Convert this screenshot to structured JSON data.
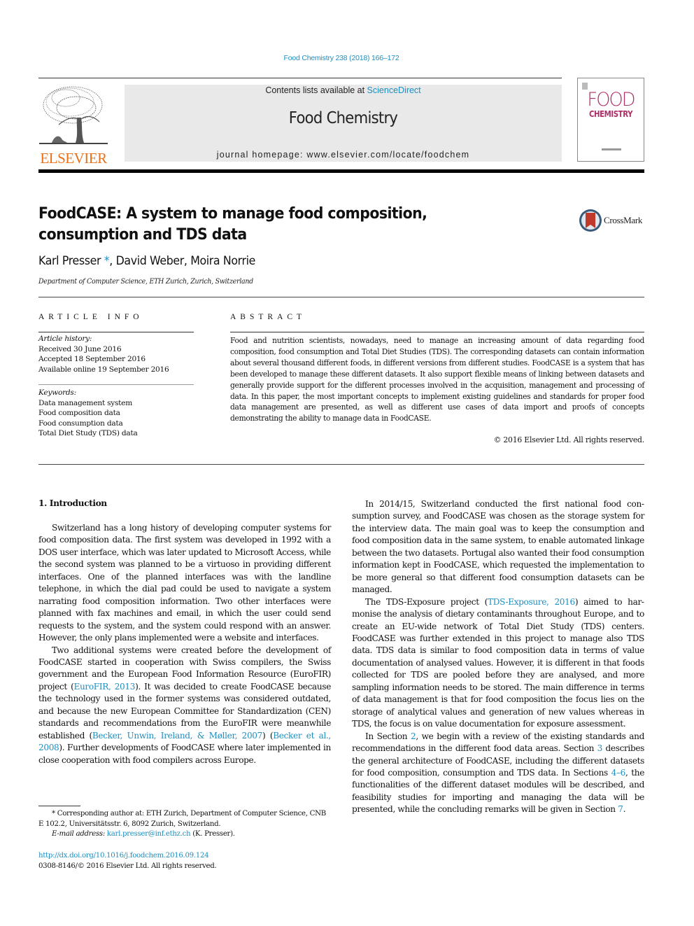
{
  "journal_ref": "Food Chemistry 238 (2018) 166–172",
  "masthead": {
    "contents_prefix": "Contents lists available at ",
    "contents_link": "ScienceDirect",
    "journal_name": "Food Chemistry",
    "homepage": "journal homepage: www.elsevier.com/locate/foodchem",
    "publisher_logo_text": "ELSEVIER",
    "publisher_logo_icon": "elsevier-tree-icon",
    "cover": {
      "line1": "FOOD",
      "line2": "CHEMISTRY"
    },
    "colors": {
      "link": "#1f8ec0",
      "elsevier": "#e9711c",
      "cover": "#b0306a",
      "masthead_bg": "#e9e9e9"
    }
  },
  "article": {
    "title": "FoodCASE: A system to manage food composition, consumption and TDS data",
    "crossmark_label": "CrossMark",
    "authors": [
      {
        "name": "Karl Presser",
        "corresponding_mark": "*"
      },
      {
        "name": "David Weber"
      },
      {
        "name": "Moira Norrie"
      }
    ],
    "author_separator": ", ",
    "affiliation": "Department of Computer Science, ETH Zurich, Zurich, Switzerland"
  },
  "article_info": {
    "label": "ARTICLE INFO",
    "history_label": "Article history:",
    "history": [
      "Received 30 June 2016",
      "Accepted 18 September 2016",
      "Available online 19 September 2016"
    ],
    "keywords_label": "Keywords:",
    "keywords": [
      "Data management system",
      "Food composition data",
      "Food consumption data",
      "Total Diet Study (TDS) data"
    ]
  },
  "abstract": {
    "label": "ABSTRACT",
    "text": "Food and nutrition scientists, nowadays, need to manage an increasing amount of data regarding food composition, food consumption and Total Diet Studies (TDS). The corresponding datasets can contain information about several thousand different foods, in different versions from different studies. FoodCASE is a system that has been developed to manage these different datasets. It also support flexible means of linking between datasets and generally provide support for the different processes involved in the acquisition, management and processing of data. In this paper, the most important concepts to imple­ment existing guidelines and standards for proper food data management are presented, as well as dif­ferent use cases of data import and proofs of concepts demonstrating the ability to manage data in FoodCASE.",
    "copyright": "© 2016 Elsevier Ltd. All rights reserved."
  },
  "body": {
    "section_heading": "1. Introduction",
    "left_paragraphs": [
      [
        {
          "t": "Switzerland has a long history of developing computer systems for food composition data. The first system was developed in 1992 with a DOS user interface, which was later updated to Microsoft Access, while the second system was planned to be a virtuoso in providing different interfaces. One of the planned interfaces was with the landline telephone, in which the dial pad could be used to navigate a system narrating food composition information. Two other interfaces were planned with fax machines and email, in which the user could send requests to the system, and the sys­tem could respond with an answer. However, the only plans imple­mented were a website and interfaces."
        }
      ],
      [
        {
          "t": "Two additional systems were created before the development of FoodCASE started in cooperation with Swiss compilers, the Swiss government and the European Food Information Resource (Euro­FIR) project ("
        },
        {
          "t": "EuroFIR, 2013",
          "link": true
        },
        {
          "t": "). It was decided to create FoodCASE because the technology used in the former systems was considered outdated, and because the new European Committee for Standard­ization (CEN) standards and recommendations from the EuroFIR were meanwhile established ("
        },
        {
          "t": "Becker, Unwin, Ireland, & Møller, 2007",
          "link": true
        },
        {
          "t": ") ("
        },
        {
          "t": "Becker et al., 2008",
          "link": true
        },
        {
          "t": "). Further developments of FoodCASE where later implemented in close cooperation with food compilers across Europe."
        }
      ]
    ],
    "right_paragraphs": [
      [
        {
          "t": "In 2014/15, Switzerland conducted the first national food con­sumption survey, and FoodCASE was chosen as the storage system for the interview data. The main goal was to keep the consumption and food composition data in the same system, to enable auto­mated linkage between the two datasets. Portugal also wanted their food consumption information kept in FoodCASE, which requested the implementation to be more general so that different food consumption datasets can be managed."
        }
      ],
      [
        {
          "t": "The TDS-Exposure project ("
        },
        {
          "t": "TDS-Exposure, 2016",
          "link": true
        },
        {
          "t": ") aimed to har­monise the analysis of dietary contaminants throughout Europe, and to create an EU-wide network of Total Diet Study (TDS) cen­ters. FoodCASE was further extended in this project to manage also TDS data. TDS data is similar to food composition data in terms of value documentation of analysed values. However, it is different in that foods collected for TDS are pooled before they are analysed, and more sampling information needs to be stored. The main dif­ference in terms of data management is that for food composition the focus lies on the storage of analytical values and generation of new values whereas in TDS, the focus is on value documentation for exposure assessment."
        }
      ],
      [
        {
          "t": "In Section "
        },
        {
          "t": "2",
          "link": true
        },
        {
          "t": ", we begin with a review of the existing standards and recommendations in the different food data areas. Section "
        },
        {
          "t": "3",
          "link": true
        },
        {
          "t": " describes the general architecture of FoodCASE, including the dif­ferent datasets for food composition, consumption and TDS data. In Sections "
        },
        {
          "t": "4–6",
          "link": true
        },
        {
          "t": ", the functionalities of the different dataset modules will be described, and feasibility studies for importing and manag­ing the data will be presented, while the concluding remarks will be given in Section "
        },
        {
          "t": "7",
          "link": true
        },
        {
          "t": "."
        }
      ]
    ]
  },
  "footnote": {
    "corresponding": "* Corresponding author at: ETH Zurich, Department of Computer Science, CNB E 102.2, Universitätsstr. 6, 8092 Zurich, Switzerland.",
    "email_label": "E-mail address: ",
    "email": "karl.presser@inf.ethz.ch",
    "email_suffix": " (K. Presser)."
  },
  "doi": {
    "url": "http://dx.doi.org/10.1016/j.foodchem.2016.09.124",
    "issn_line": "0308-8146/© 2016 Elsevier Ltd. All rights reserved."
  }
}
